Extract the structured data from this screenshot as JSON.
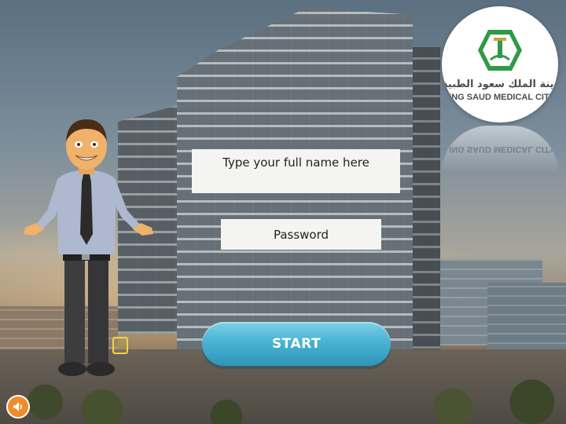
{
  "login": {
    "name_placeholder": "Type your full name here",
    "password_placeholder": "Password",
    "start_label": "START"
  },
  "logo": {
    "arabic_text": "مدينة الملك سعود الطبية",
    "english_text": "ING SAUD MEDICAL CITY",
    "reflection_text": "ING SAUD MEDICAL CITY"
  },
  "icons": {
    "audio": "audio-speaker-icon",
    "marker": "marker-icon",
    "character": "presenter-character",
    "logo": "hospital-logo-icon"
  },
  "colors": {
    "accent": "#49b3d3",
    "logo_green": "#2f9a47",
    "audio_orange": "#f08a2a"
  }
}
